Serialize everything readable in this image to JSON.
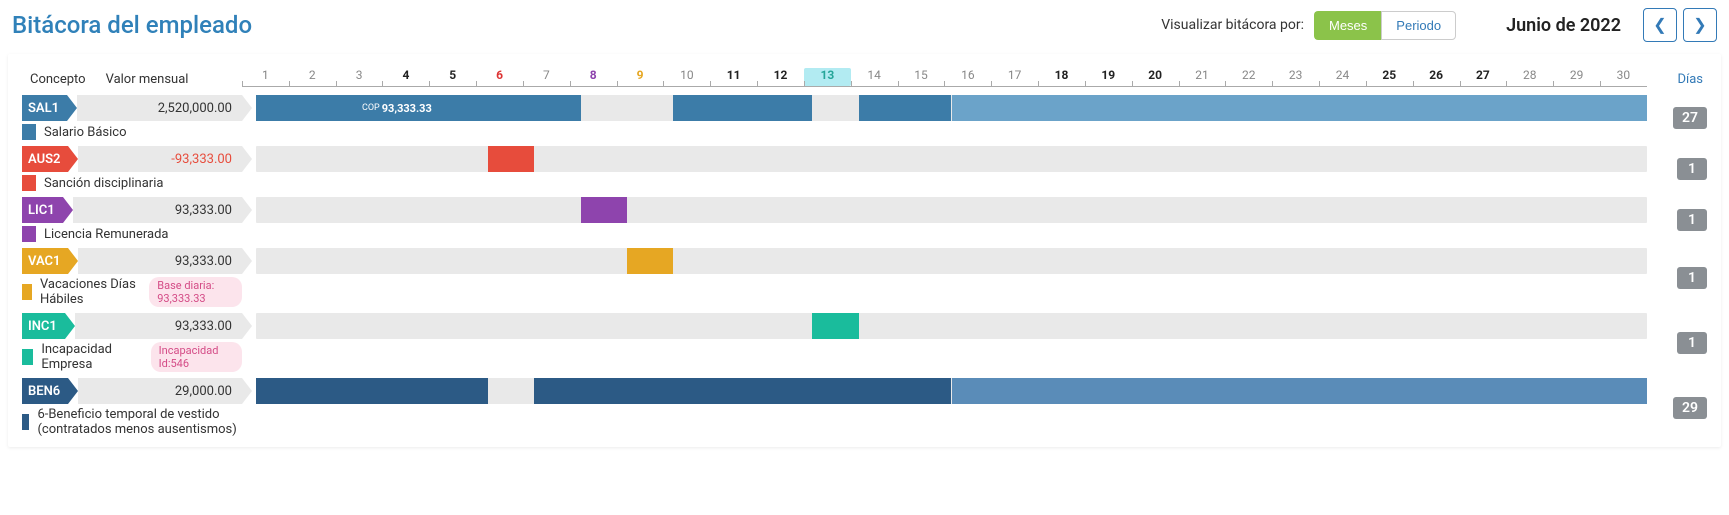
{
  "header": {
    "title": "Bitácora del empleado",
    "view_label": "Visualizar bitácora por:",
    "btn_months": "Meses",
    "btn_period": "Periodo",
    "month": "Junio de 2022"
  },
  "columns": {
    "concepto": "Concepto",
    "valor": "Valor mensual",
    "dias": "Días"
  },
  "days": [
    {
      "n": "1",
      "cls": ""
    },
    {
      "n": "2",
      "cls": ""
    },
    {
      "n": "3",
      "cls": ""
    },
    {
      "n": "4",
      "cls": "bold"
    },
    {
      "n": "5",
      "cls": "bold"
    },
    {
      "n": "6",
      "cls": "red"
    },
    {
      "n": "7",
      "cls": ""
    },
    {
      "n": "8",
      "cls": "purple"
    },
    {
      "n": "9",
      "cls": "orange"
    },
    {
      "n": "10",
      "cls": ""
    },
    {
      "n": "11",
      "cls": "bold"
    },
    {
      "n": "12",
      "cls": "bold"
    },
    {
      "n": "13",
      "cls": "teal-hl"
    },
    {
      "n": "14",
      "cls": ""
    },
    {
      "n": "15",
      "cls": ""
    },
    {
      "n": "16",
      "cls": ""
    },
    {
      "n": "17",
      "cls": ""
    },
    {
      "n": "18",
      "cls": "bold"
    },
    {
      "n": "19",
      "cls": "bold"
    },
    {
      "n": "20",
      "cls": "bold"
    },
    {
      "n": "21",
      "cls": ""
    },
    {
      "n": "22",
      "cls": ""
    },
    {
      "n": "23",
      "cls": ""
    },
    {
      "n": "24",
      "cls": ""
    },
    {
      "n": "25",
      "cls": "bold"
    },
    {
      "n": "26",
      "cls": "bold"
    },
    {
      "n": "27",
      "cls": "bold"
    },
    {
      "n": "28",
      "cls": ""
    },
    {
      "n": "29",
      "cls": ""
    },
    {
      "n": "30",
      "cls": ""
    }
  ],
  "rows": [
    {
      "code": "SAL1",
      "color": "blue",
      "value": "2,520,000.00",
      "neg": false,
      "desc": "Salario Básico",
      "badge": null,
      "days": "27",
      "segments": [
        {
          "start": 0,
          "end": 7,
          "color": "#3c7ca8"
        },
        {
          "start": 9,
          "end": 12,
          "color": "#3c7ca8"
        },
        {
          "start": 13,
          "end": 15,
          "color": "#3c7ca8"
        },
        {
          "start": 15,
          "end": 30,
          "color": "#6ba3c9"
        }
      ],
      "label": {
        "at": 2.2,
        "currency": "COP",
        "text": "93,333.33"
      }
    },
    {
      "code": "AUS2",
      "color": "red",
      "value": "-93,333.00",
      "neg": true,
      "desc": "Sanción disciplinaria",
      "badge": null,
      "days": "1",
      "segments": [
        {
          "start": 5,
          "end": 6,
          "color": "#e74c3c"
        }
      ],
      "label": null
    },
    {
      "code": "LIC1",
      "color": "purple",
      "value": "93,333.00",
      "neg": false,
      "desc": "Licencia Remunerada",
      "badge": null,
      "days": "1",
      "segments": [
        {
          "start": 7,
          "end": 8,
          "color": "#8e44ad"
        }
      ],
      "label": null
    },
    {
      "code": "VAC1",
      "color": "orange",
      "value": "93,333.00",
      "neg": false,
      "desc": "Vacaciones Días Hábiles",
      "badge": "Base diaria: 93,333.33",
      "days": "1",
      "segments": [
        {
          "start": 8,
          "end": 9,
          "color": "#e6a723"
        }
      ],
      "label": null
    },
    {
      "code": "INC1",
      "color": "teal",
      "value": "93,333.00",
      "neg": false,
      "desc": "Incapacidad Empresa",
      "badge": "Incapacidad Id:546",
      "days": "1",
      "segments": [
        {
          "start": 12,
          "end": 13,
          "color": "#1abc9c"
        }
      ],
      "label": null
    },
    {
      "code": "BEN6",
      "color": "navy",
      "value": "29,000.00",
      "neg": false,
      "desc": "6-Beneficio temporal de vestido (contratados menos ausentismos)",
      "badge": null,
      "days": "29",
      "segments": [
        {
          "start": 0,
          "end": 5,
          "color": "#2c5a85"
        },
        {
          "start": 6,
          "end": 15,
          "color": "#2c5a85"
        },
        {
          "start": 15,
          "end": 30,
          "color": "#5a8cb8"
        }
      ],
      "label": null
    }
  ]
}
